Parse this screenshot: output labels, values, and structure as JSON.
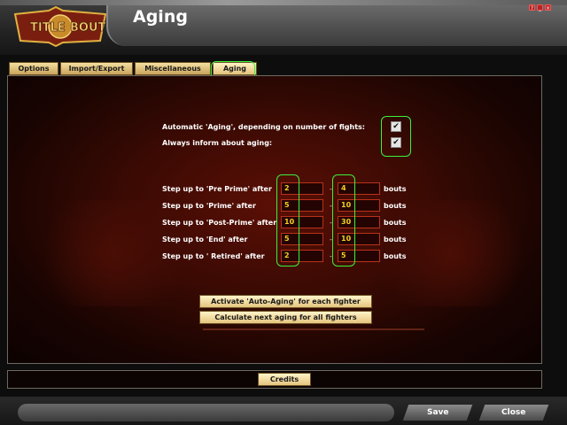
{
  "app": {
    "logo_text": "TITLE BOUT",
    "title": "Aging"
  },
  "window_controls": [
    "help-icon",
    "minimize-icon",
    "close-icon"
  ],
  "tabs": [
    {
      "label": "Options",
      "active": false
    },
    {
      "label": "Import/Export",
      "active": false
    },
    {
      "label": "Miscellaneous",
      "active": false
    },
    {
      "label": "Aging",
      "active": true
    }
  ],
  "settings": {
    "auto_aging_label": "Automatic 'Aging', depending on number of fights:",
    "auto_aging_checked": true,
    "inform_label": "Always inform about aging:",
    "inform_checked": true
  },
  "steps": [
    {
      "label": "Step up to 'Pre Prime' after",
      "min": "2",
      "max": "4",
      "unit": "bouts"
    },
    {
      "label": "Step up to 'Prime' after",
      "min": "5",
      "max": "10",
      "unit": "bouts"
    },
    {
      "label": "Step up to 'Post-Prime' after",
      "min": "10",
      "max": "30",
      "unit": "bouts"
    },
    {
      "label": "Step up to 'End' after",
      "min": "5",
      "max": "10",
      "unit": "bouts"
    },
    {
      "label": "Step up to ' Retired' after",
      "min": "2",
      "max": "5",
      "unit": "bouts"
    }
  ],
  "range_separator": "-",
  "buttons": {
    "activate": "Activate 'Auto-Aging' for each fighter",
    "calculate": "Calculate next aging for all fighters",
    "credits": "Credits",
    "save": "Save",
    "close": "Close"
  },
  "colors": {
    "highlight": "#3cf03c",
    "input_text": "#f2d020",
    "input_border": "#b8321a"
  }
}
